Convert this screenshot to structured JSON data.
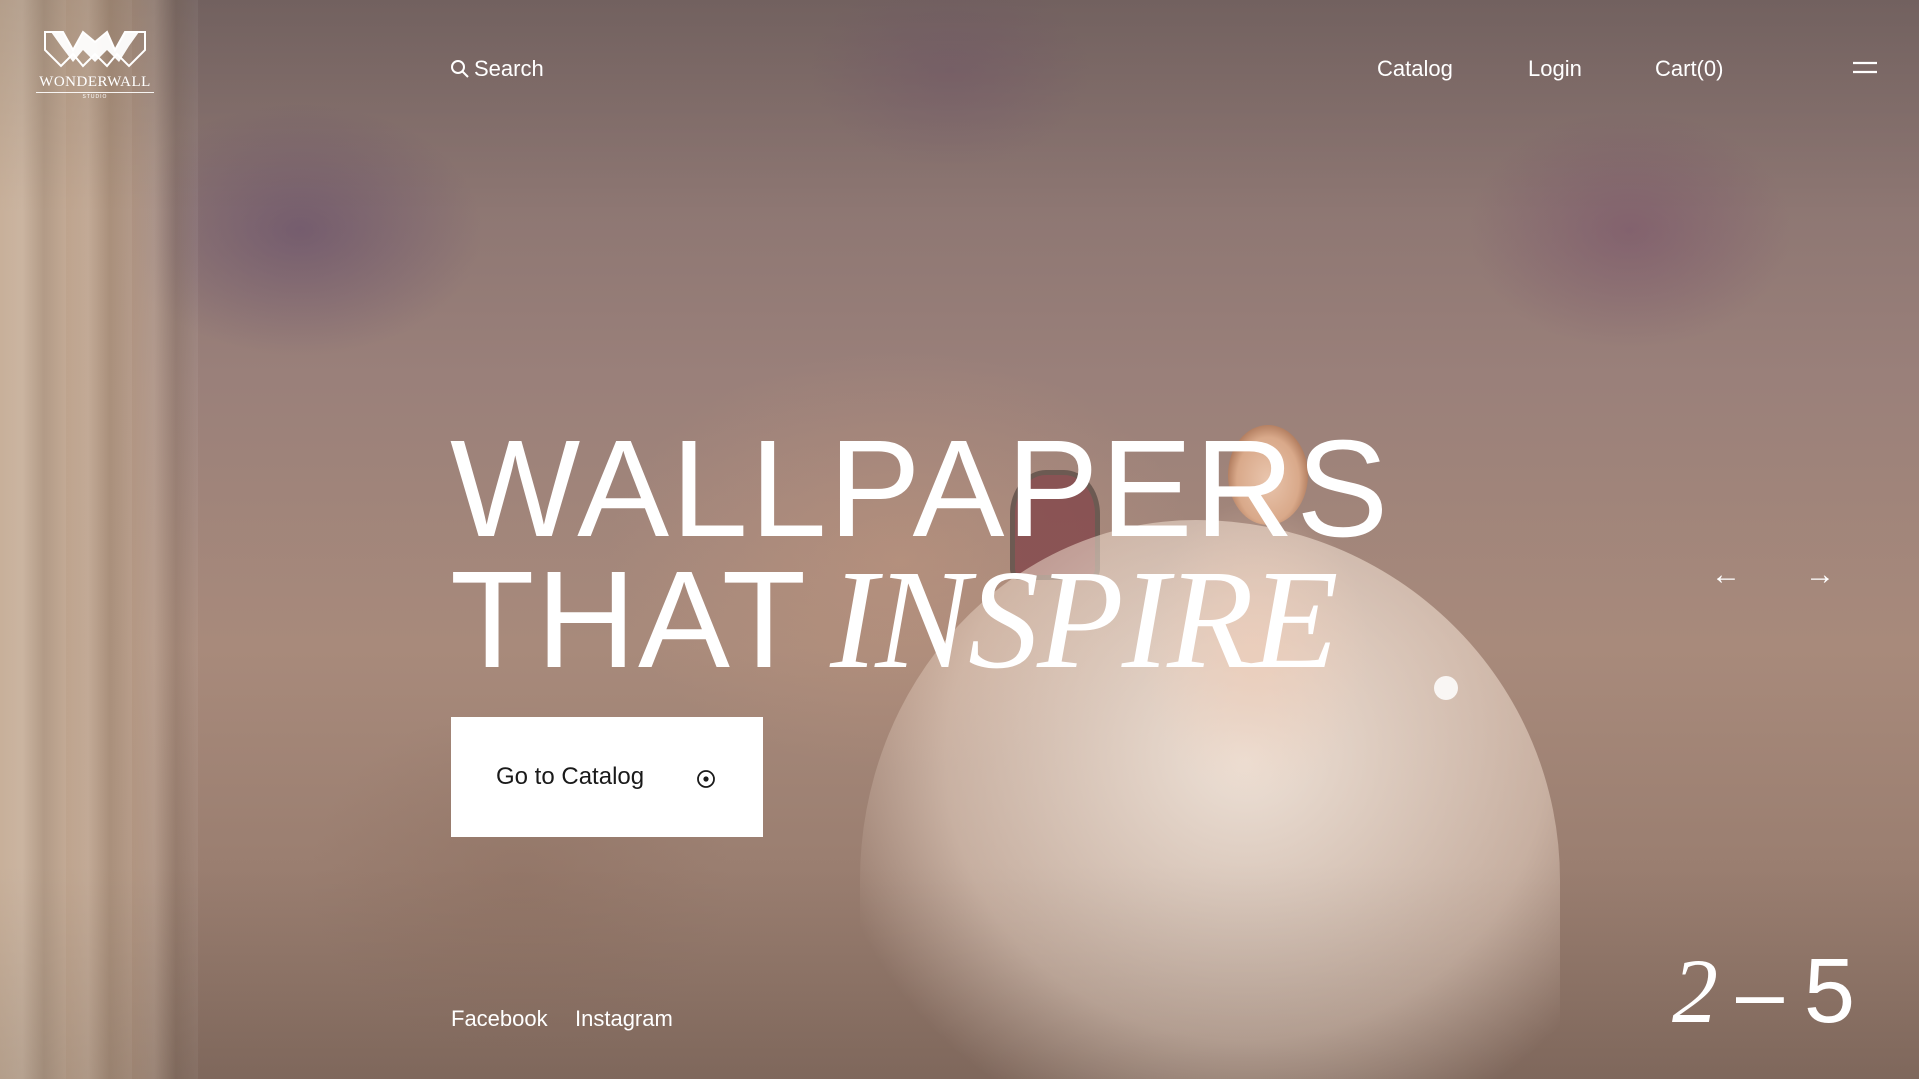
{
  "brand": {
    "name": "WONDERWALL",
    "sub": "STUDIO"
  },
  "header": {
    "search_label": "Search",
    "nav": {
      "catalog": "Catalog",
      "login": "Login",
      "cart": "Cart(0)"
    }
  },
  "hero": {
    "line1": "WALLPAPERS",
    "line2_regular": "THAT",
    "line2_italic": "INSPIRE",
    "cta_label": "Go to Catalog"
  },
  "slider": {
    "prev_arrow": "←",
    "next_arrow": "→",
    "current": "2",
    "separator": "–",
    "total": "5"
  },
  "social": {
    "facebook": "Facebook",
    "instagram": "Instagram"
  },
  "icons": {
    "logo": "wonderwall-logo-icon",
    "search": "search-icon",
    "menu": "menu-icon",
    "cta": "target-icon"
  },
  "colors": {
    "text": "#ffffff",
    "cta_bg": "#ffffff",
    "cta_text": "#1a1a1a"
  }
}
